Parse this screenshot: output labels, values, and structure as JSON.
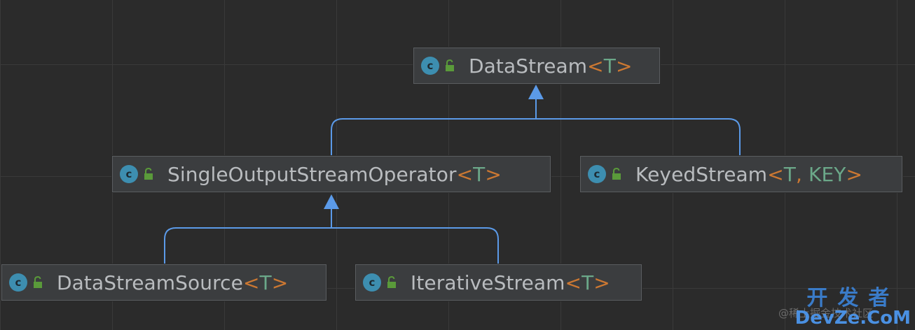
{
  "nodes": {
    "datastream": {
      "name": "DataStream",
      "params": [
        "T"
      ]
    },
    "single_output": {
      "name": "SingleOutputStreamOperator",
      "params": [
        "T"
      ]
    },
    "keyed": {
      "name": "KeyedStream",
      "params": [
        "T",
        "KEY"
      ]
    },
    "source": {
      "name": "DataStreamSource",
      "params": [
        "T"
      ]
    },
    "iterative": {
      "name": "IterativeStream",
      "params": [
        "T"
      ]
    }
  },
  "edges": [
    {
      "from": "single_output",
      "to": "datastream"
    },
    {
      "from": "keyed",
      "to": "datastream"
    },
    {
      "from": "source",
      "to": "single_output"
    },
    {
      "from": "iterative",
      "to": "single_output"
    }
  ],
  "icons": {
    "class": "class-icon",
    "access": "unlocked-icon"
  },
  "colors": {
    "edge": "#5b9ae8",
    "class_icon": "#3d8eb0",
    "type_param": "#6ba889",
    "punctuation": "#cc7832"
  },
  "watermark": {
    "cn": "开发者",
    "en": "DevZe.CoM",
    "faint": "@稀土掘金技术社区"
  }
}
